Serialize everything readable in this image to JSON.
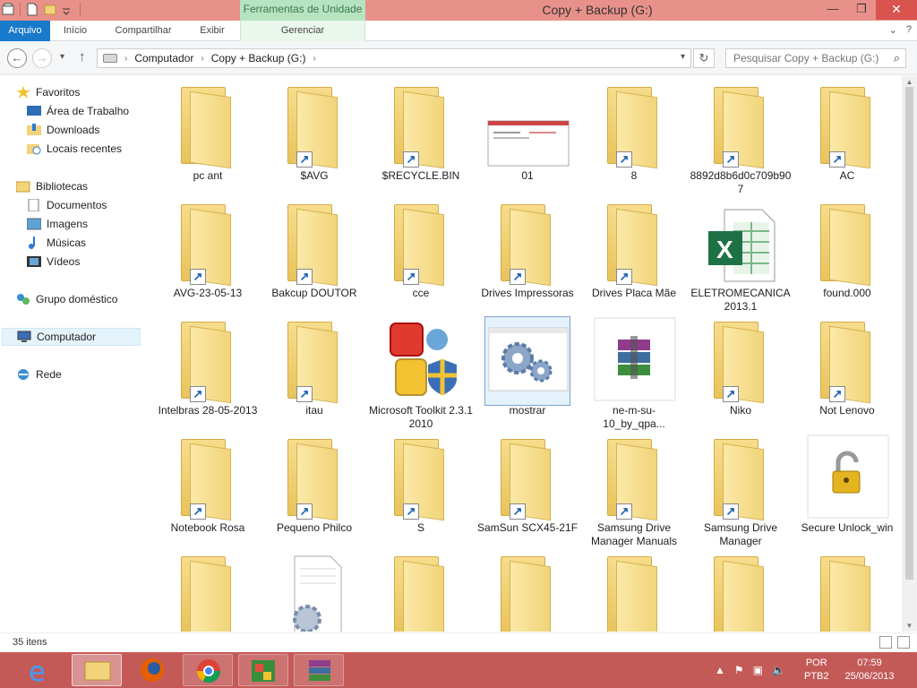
{
  "window": {
    "title": "Copy + Backup (G:)",
    "context_group": "Ferramentas de Unidade",
    "minimize_glyph": "—",
    "maximize_glyph": "❐",
    "close_glyph": "✕"
  },
  "ribbon": {
    "file_tab": "Arquivo",
    "tabs": [
      "Início",
      "Compartilhar",
      "Exibir"
    ],
    "context_tab": "Gerenciar",
    "expand_glyph": "⌄",
    "help_glyph": "?"
  },
  "address": {
    "crumbs": [
      "Computador",
      "Copy + Backup (G:)"
    ],
    "search_placeholder": "Pesquisar Copy + Backup (G:)"
  },
  "nav_pane": {
    "favorites_label": "Favoritos",
    "favorites": [
      "Área de Trabalho",
      "Downloads",
      "Locais recentes"
    ],
    "libraries_label": "Bibliotecas",
    "libraries": [
      "Documentos",
      "Imagens",
      "Músicas",
      "Vídeos"
    ],
    "homegroup": "Grupo doméstico",
    "computer": "Computador",
    "network": "Rede"
  },
  "files": [
    {
      "name": "pc ant",
      "type": "folder",
      "shortcut": false
    },
    {
      "name": "$AVG",
      "type": "folder",
      "shortcut": true
    },
    {
      "name": "$RECYCLE.BIN",
      "type": "folder",
      "shortcut": true
    },
    {
      "name": "01",
      "type": "image",
      "shortcut": false
    },
    {
      "name": "8",
      "type": "folder",
      "shortcut": true
    },
    {
      "name": "8892d8b6d0c709b907",
      "type": "folder",
      "shortcut": true
    },
    {
      "name": "AC",
      "type": "folder",
      "shortcut": true
    },
    {
      "name": "AVG-23-05-13",
      "type": "folder",
      "shortcut": true
    },
    {
      "name": "Bakcup DOUTOR",
      "type": "folder",
      "shortcut": true
    },
    {
      "name": "cce",
      "type": "folder",
      "shortcut": true
    },
    {
      "name": "Drives Impressoras",
      "type": "folder",
      "shortcut": true
    },
    {
      "name": "Drives Placa Mãe",
      "type": "folder",
      "shortcut": true
    },
    {
      "name": "ELETROMECANICA 2013.1",
      "type": "excel",
      "shortcut": false
    },
    {
      "name": "found.000",
      "type": "folder",
      "shortcut": false
    },
    {
      "name": "Intelbras 28-05-2013",
      "type": "folder",
      "shortcut": true
    },
    {
      "name": "itau",
      "type": "folder",
      "shortcut": true
    },
    {
      "name": "Microsoft Toolkit 2.3.1 2010",
      "type": "office",
      "shortcut": false
    },
    {
      "name": "mostrar",
      "type": "settings",
      "shortcut": false
    },
    {
      "name": "ne-m-su-10_by_qpa...",
      "type": "winrar",
      "shortcut": false
    },
    {
      "name": "Niko",
      "type": "folder",
      "shortcut": true
    },
    {
      "name": "Not Lenovo",
      "type": "folder",
      "shortcut": true
    },
    {
      "name": "Notebook Rosa",
      "type": "folder",
      "shortcut": true
    },
    {
      "name": "Pequeno Philco",
      "type": "folder",
      "shortcut": true
    },
    {
      "name": "S",
      "type": "folder",
      "shortcut": true
    },
    {
      "name": "SamSun SCX45-21F",
      "type": "folder",
      "shortcut": true
    },
    {
      "name": "Samsung Drive Manager Manuals",
      "type": "folder",
      "shortcut": true
    },
    {
      "name": "Samsung Drive Manager",
      "type": "folder",
      "shortcut": true
    },
    {
      "name": "Secure Unlock_win",
      "type": "lock",
      "shortcut": false
    },
    {
      "name": "",
      "type": "folder",
      "shortcut": false
    },
    {
      "name": "",
      "type": "config",
      "shortcut": false
    },
    {
      "name": "",
      "type": "folder",
      "shortcut": false
    },
    {
      "name": "",
      "type": "folder",
      "shortcut": false
    },
    {
      "name": "",
      "type": "folder",
      "shortcut": false
    },
    {
      "name": "",
      "type": "folder",
      "shortcut": false
    },
    {
      "name": "",
      "type": "folder",
      "shortcut": false
    }
  ],
  "status": {
    "item_count": "35 itens"
  },
  "taskbar": {
    "apps": [
      "internet-explorer",
      "file-explorer",
      "firefox",
      "chrome",
      "avg",
      "winrar"
    ],
    "lang_top": "POR",
    "lang_bottom": "PTB2",
    "time": "07:59",
    "date": "25/06/2013"
  },
  "colors": {
    "titlebar": "#e8918a",
    "file_tab": "#1979ca",
    "context_tab": "#b6e3c0",
    "taskbar": "#c45a58"
  }
}
